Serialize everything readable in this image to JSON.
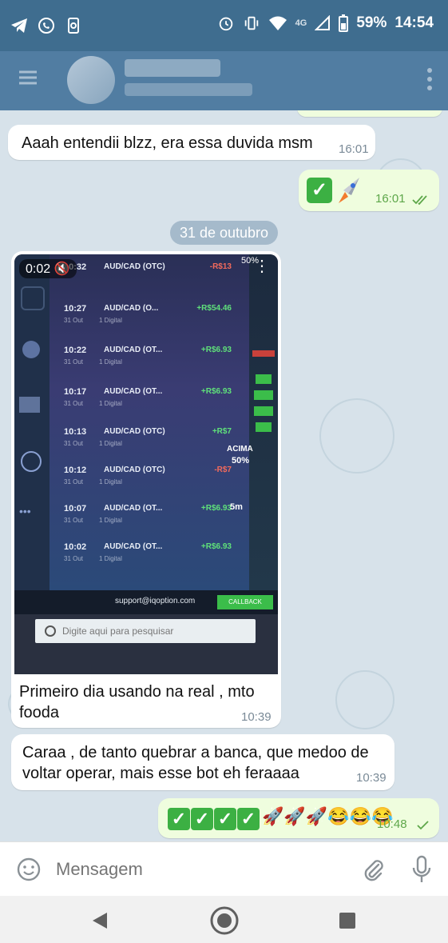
{
  "status_bar": {
    "battery": "59%",
    "time": "14:54",
    "network": "4G"
  },
  "messages": {
    "m1": {
      "text": "Aaah entendii blzz, era essa duvida msm",
      "time": "16:01"
    },
    "m2": {
      "emoji": "✅🚀",
      "time": "16:01"
    },
    "date_separator": "31 de outubro",
    "video": {
      "duration": "0:02",
      "caption": "Primeiro dia usando na real , mto fooda",
      "time": "10:39",
      "rows": [
        {
          "time": "10:32",
          "pair": "AUD/CAD (OTC)",
          "value": "-R$13"
        },
        {
          "time": "10:27",
          "pair": "AUD/CAD (O...",
          "value": "+R$54.46",
          "date": "31 Out",
          "sub": "1 Digital"
        },
        {
          "time": "10:22",
          "pair": "AUD/CAD (OT...",
          "value": "+R$6.93",
          "date": "31 Out",
          "sub": "1 Digital"
        },
        {
          "time": "10:17",
          "pair": "AUD/CAD (OT...",
          "value": "+R$6.93",
          "date": "31 Out",
          "sub": "1 Digital"
        },
        {
          "time": "10:13",
          "pair": "AUD/CAD (OTC)",
          "value": "+R$7",
          "date": "31 Out",
          "sub": "1 Digital"
        },
        {
          "time": "10:12",
          "pair": "AUD/CAD (OTC)",
          "value": "-R$7",
          "date": "31 Out",
          "sub": "1 Digital"
        },
        {
          "time": "10:07",
          "pair": "AUD/CAD (OT...",
          "value": "+R$6.93",
          "date": "31 Out",
          "sub": "1 Digital"
        },
        {
          "time": "10:02",
          "pair": "AUD/CAD (OT...",
          "value": "+R$6.93",
          "date": "31 Out",
          "sub": "1 Digital"
        }
      ],
      "chart_label": "ACIMA",
      "chart_percent": "50%",
      "top_percent": "50%",
      "timeframe": "5m",
      "footer_text": "support@iqoption.com",
      "footer_button": "CALLBACK",
      "search_placeholder": "Digite aqui para pesquisar"
    },
    "m3": {
      "text": "Caraa , de tanto quebrar a banca, que medoo de voltar operar, mais esse bot eh feraaaa",
      "time": "10:39"
    },
    "m4": {
      "emoji": "🚀🚀🚀😂😂😂",
      "time": "10:48"
    }
  },
  "input": {
    "placeholder": "Mensagem"
  }
}
